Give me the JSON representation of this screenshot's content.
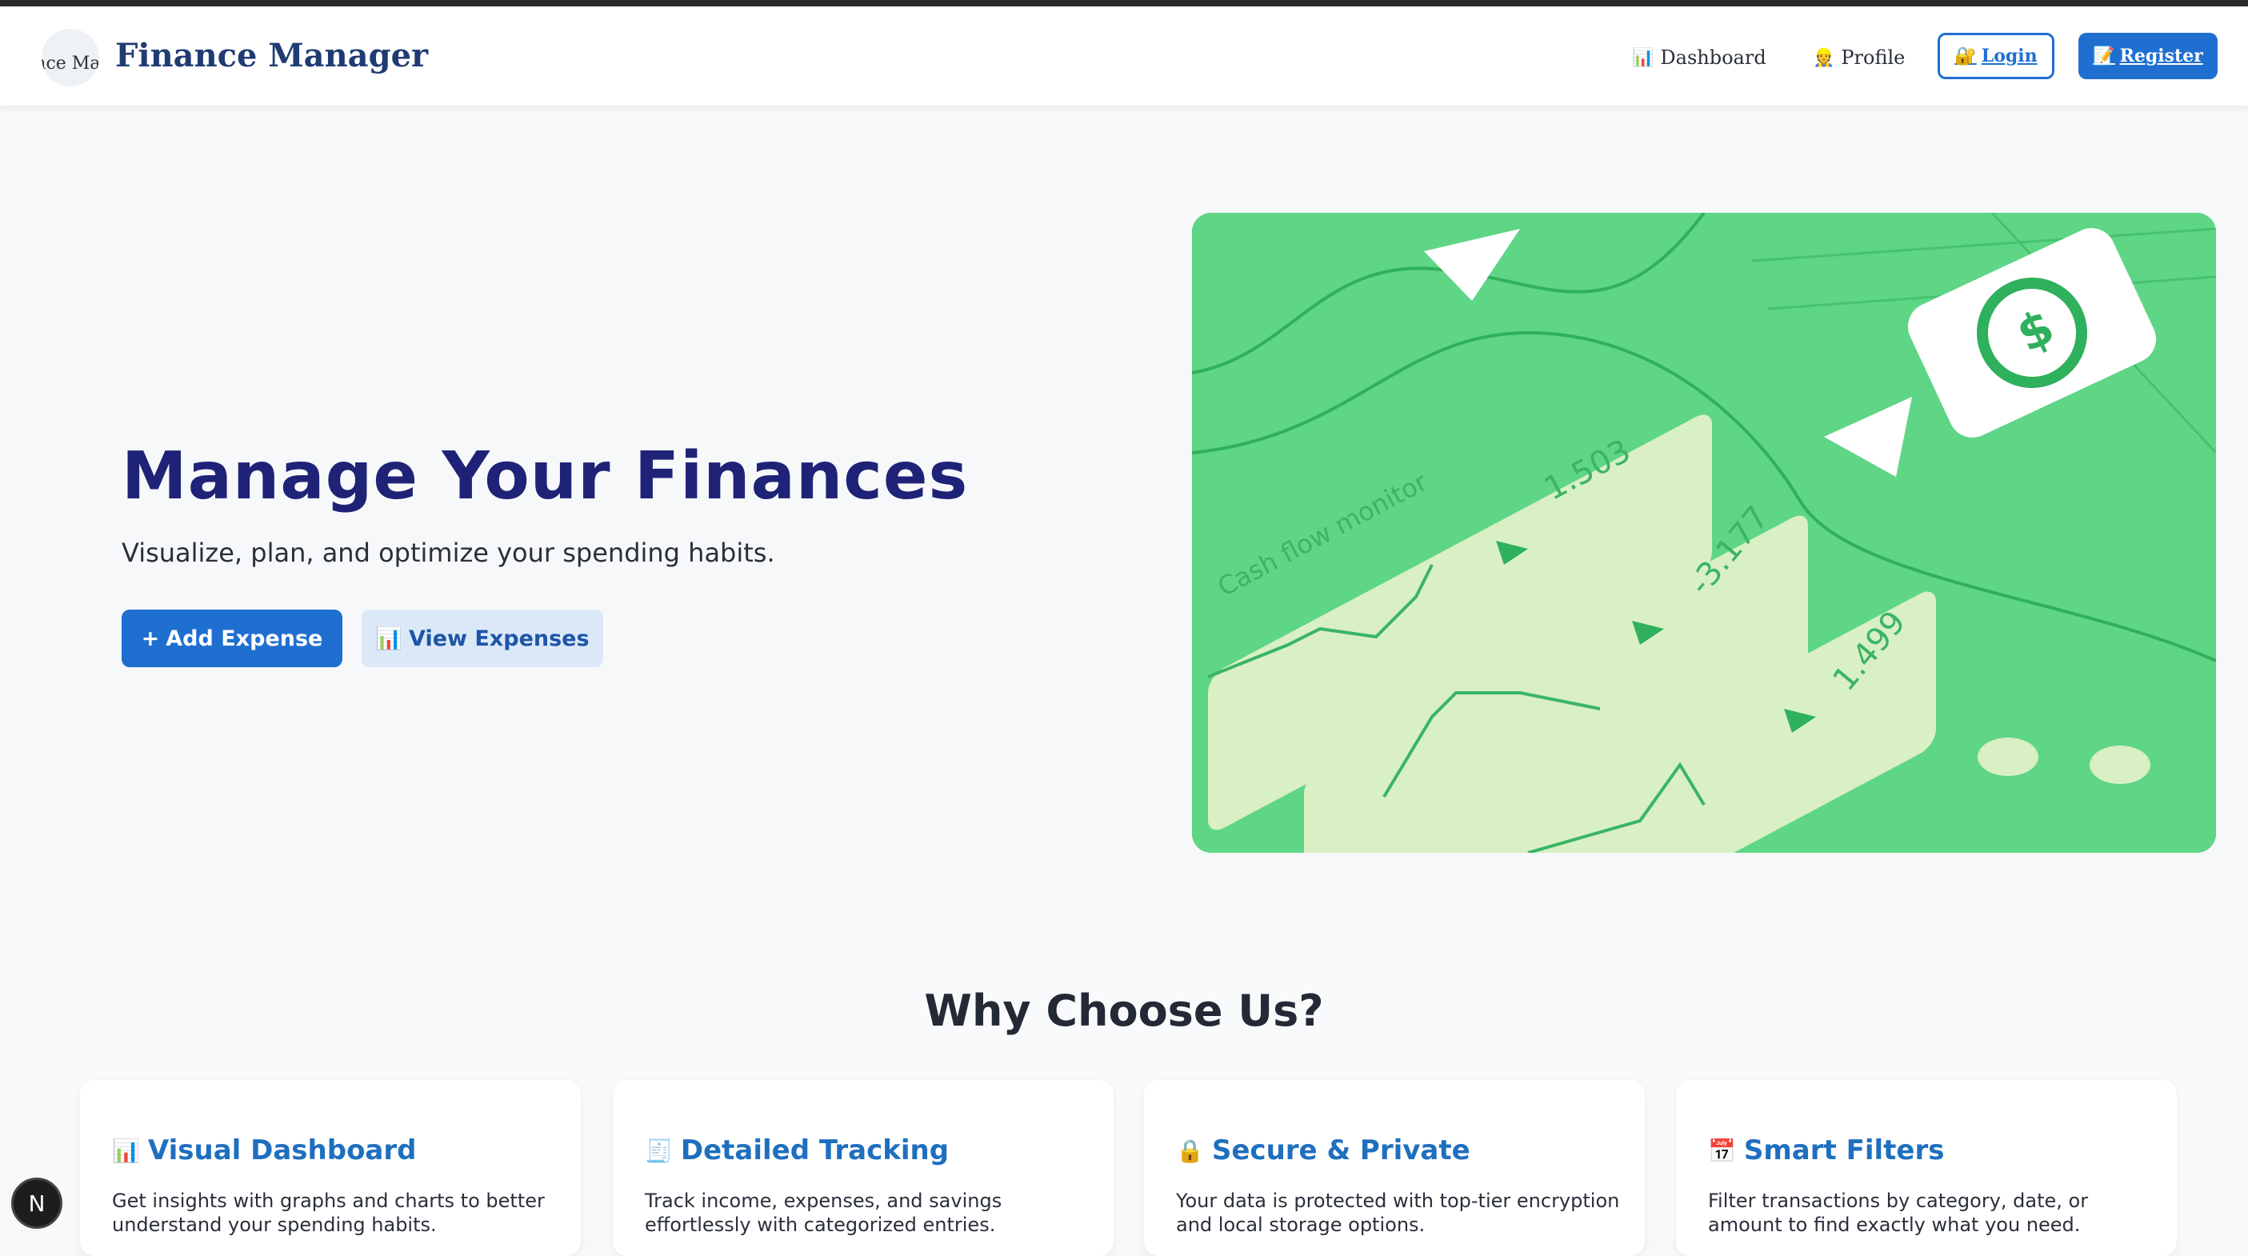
{
  "header": {
    "logo_text": "Finance Manager",
    "brand": "Finance Manager",
    "nav": {
      "dashboard": {
        "icon": "📊",
        "label": "Dashboard"
      },
      "profile": {
        "icon": "👷",
        "label": "Profile"
      },
      "login": {
        "icon": "🔐",
        "label": "Login"
      },
      "register": {
        "icon": "📝",
        "label": "Register"
      }
    }
  },
  "hero": {
    "title": "Manage Your Finances",
    "subtitle": "Visualize, plan, and optimize your spending habits.",
    "add_expense": {
      "icon": "+",
      "label": "Add Expense"
    },
    "view_expenses": {
      "icon": "📊",
      "label": "View Expenses"
    },
    "image": {
      "label": "Cash flow monitor",
      "values": [
        "1.503",
        "-3.177",
        "1.499"
      ]
    }
  },
  "why": {
    "title": "Why Choose Us?",
    "cards": [
      {
        "icon": "📊",
        "title": "Visual Dashboard",
        "text": "Get insights with graphs and charts to better understand your spending habits."
      },
      {
        "icon": "🧾",
        "title": "Detailed Tracking",
        "text": "Track income, expenses, and savings effortlessly with categorized entries."
      },
      {
        "icon": "🔒",
        "title": "Secure & Private",
        "text": "Your data is protected with top-tier encryption and local storage options."
      },
      {
        "icon": "📅",
        "title": "Smart Filters",
        "text": "Filter transactions by category, date, or amount to find exactly what you need."
      }
    ]
  },
  "dev_badge": "N",
  "colors": {
    "brand": "#1f3b73",
    "primary": "#1f6fd1",
    "hero_title": "#1f2377",
    "card_title": "#1f6fbf",
    "hero_image_green": "#5fd586"
  }
}
